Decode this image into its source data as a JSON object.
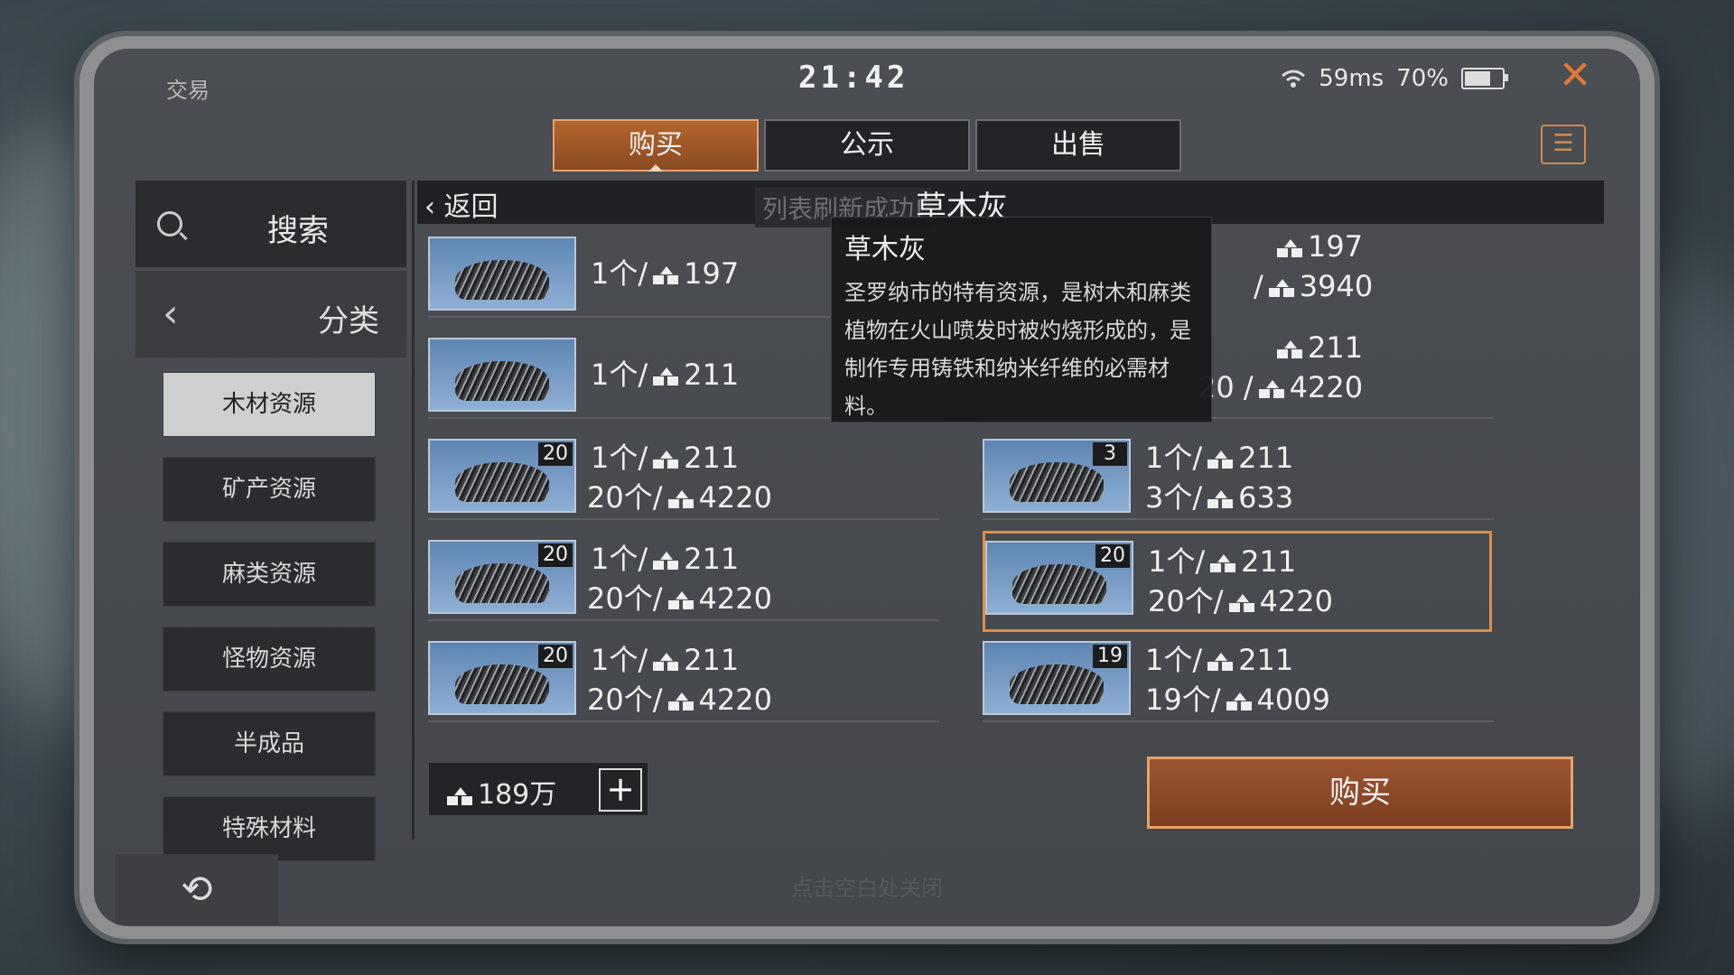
{
  "header": {
    "app_title": "交易",
    "clock": "21:42",
    "ping": "59ms",
    "battery": "70%",
    "battery_level": 0.7,
    "close_icon": "close-icon",
    "clipboard_icon": "clipboard-icon"
  },
  "tabs": [
    {
      "label": "购买",
      "active": true
    },
    {
      "label": "公示"
    },
    {
      "label": "出售"
    }
  ],
  "sidebar": {
    "search_label": "搜索",
    "category_label": "分类",
    "categories": [
      "木材资源",
      "矿产资源",
      "麻类资源",
      "怪物资源",
      "半成品",
      "特殊材料"
    ]
  },
  "list_header": {
    "back_label": "返回",
    "toast": "列表刷新成功!",
    "item_name": "草木灰"
  },
  "listings": [
    {
      "line1": "1个/ 197",
      "line2": ""
    },
    {
      "line1": "1个/ 211",
      "line2": ""
    },
    {
      "badge": "20",
      "line1": "1个/ 211",
      "line2": "20个/ 4220"
    },
    {
      "badge": "20",
      "line1": "1个/ 211",
      "line2": "20个/ 4220"
    },
    {
      "badge": "20",
      "line1": "1个/ 211",
      "line2": "20个/ 4220"
    },
    {
      "line1": " 197",
      "line2": "/ 3940"
    },
    {
      "line1": " 211",
      "line2": "20 / 4220"
    },
    {
      "badge": "3",
      "line1": "1个/ 211",
      "line2": "3个/ 633"
    },
    {
      "badge": "20",
      "line1": "1个/ 211",
      "line2": "20个/ 4220"
    },
    {
      "badge": "19",
      "line1": "1个/ 211",
      "line2": "19个/ 4009"
    }
  ],
  "tooltip": {
    "title": "草木灰",
    "body": "圣罗纳市的特有资源，是树木和麻类植物在火山喷发时被灼烧形成的，是制作专用铸铁和纳米纤维的必需材料。"
  },
  "balance": {
    "value": "189万",
    "plus": "+"
  },
  "buy_button": "购买",
  "undo_icon": "undo-icon",
  "close_hint": "点击空白处关闭"
}
